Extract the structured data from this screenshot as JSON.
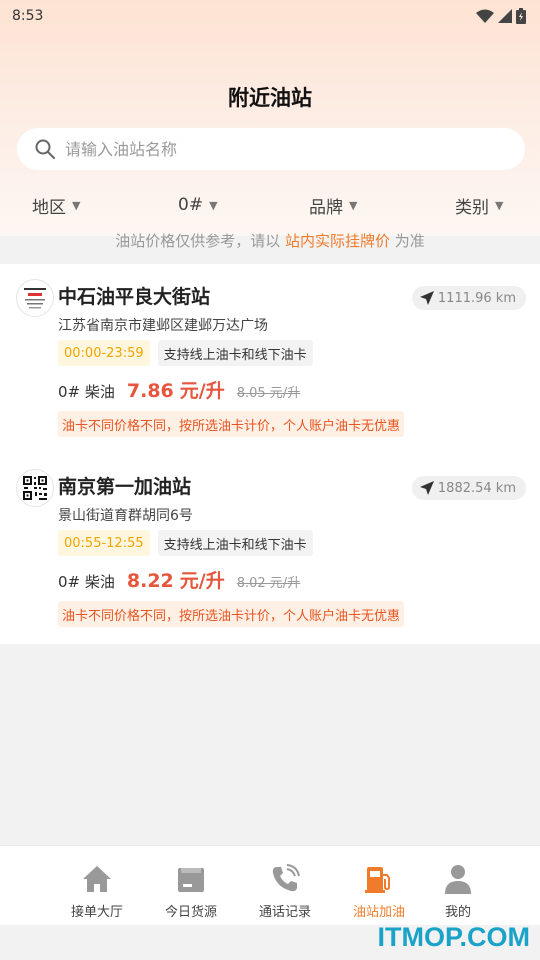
{
  "status_bar": {
    "time": "8:53",
    "icons": [
      "wifi-icon",
      "signal-icon",
      "battery-icon"
    ]
  },
  "header": {
    "title": "附近油站"
  },
  "search": {
    "placeholder": "请输入油站名称",
    "icon": "search-icon"
  },
  "filters": [
    {
      "label": "地区"
    },
    {
      "label": "0#"
    },
    {
      "label": "品牌"
    },
    {
      "label": "类别"
    }
  ],
  "notice": {
    "prefix": "油站价格仅供参考，请以",
    "highlight": "站内实际挂牌价",
    "suffix": "为准"
  },
  "stations": [
    {
      "name": "中石油平良大街站",
      "distance": "1111.96 km",
      "address": "江苏省南京市建邺区建邺万达广场",
      "hours": "00:00-23:59",
      "support": "支持线上油卡和线下油卡",
      "fuel": "0# 柴油",
      "price": "7.86",
      "unit": "元/升",
      "old_price": "8.05 元/升",
      "warning": "油卡不同价格不同，按所选油卡计价，个人账户油卡无优惠"
    },
    {
      "name": "南京第一加油站",
      "distance": "1882.54 km",
      "address": "景山街道育群胡同6号",
      "hours": "00:55-12:55",
      "support": "支持线上油卡和线下油卡",
      "fuel": "0# 柴油",
      "price": "8.22",
      "unit": "元/升",
      "old_price": "8.02 元/升",
      "warning": "油卡不同价格不同，按所选油卡计价，个人账户油卡无优惠"
    }
  ],
  "tabbar": {
    "items": [
      {
        "label": "接单大厅",
        "icon": "home-icon"
      },
      {
        "label": "今日货源",
        "icon": "box-icon"
      },
      {
        "label": "通话记录",
        "icon": "phone-icon"
      },
      {
        "label": "油站加油",
        "icon": "fuel-pump-icon",
        "active": true
      },
      {
        "label": "我的",
        "icon": "user-icon"
      }
    ]
  },
  "colors": {
    "accent": "#f07c2b",
    "price": "#e5563d",
    "time_tag": "#f0a500"
  },
  "watermark": "ITMOP.COM"
}
